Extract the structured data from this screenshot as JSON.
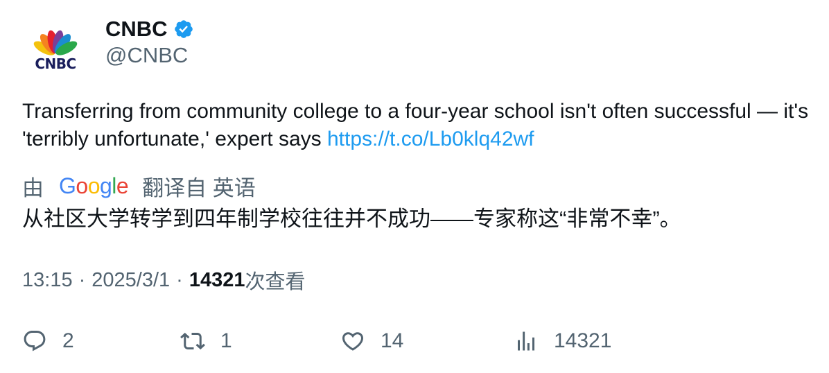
{
  "author": {
    "display_name": "CNBC",
    "handle": "@CNBC",
    "avatar_logo_text": "CNBC",
    "verified": true,
    "verified_color": "#1d9bf0"
  },
  "tweet": {
    "text": "Transferring from community college to a four-year school isn't often successful — it's 'terribly unfortunate,' expert says ",
    "link": "https://t.co/Lb0klq42wf",
    "link_color": "#1d9bf0"
  },
  "translation": {
    "prefix": "由",
    "provider": "Google",
    "suffix": "翻译自 英语",
    "text": "从社区大学转学到四年制学校往往并不成功——专家称这“非常不幸”。"
  },
  "meta": {
    "time": "13:15",
    "date": "2025/3/1",
    "views_count": "14321",
    "views_label": "次查看"
  },
  "actions": {
    "replies": "2",
    "retweets": "1",
    "likes": "14",
    "views": "14321"
  },
  "icons": [
    "reply-icon",
    "retweet-icon",
    "like-icon",
    "views-icon",
    "verified-badge-icon",
    "cnbc-peacock-icon"
  ]
}
